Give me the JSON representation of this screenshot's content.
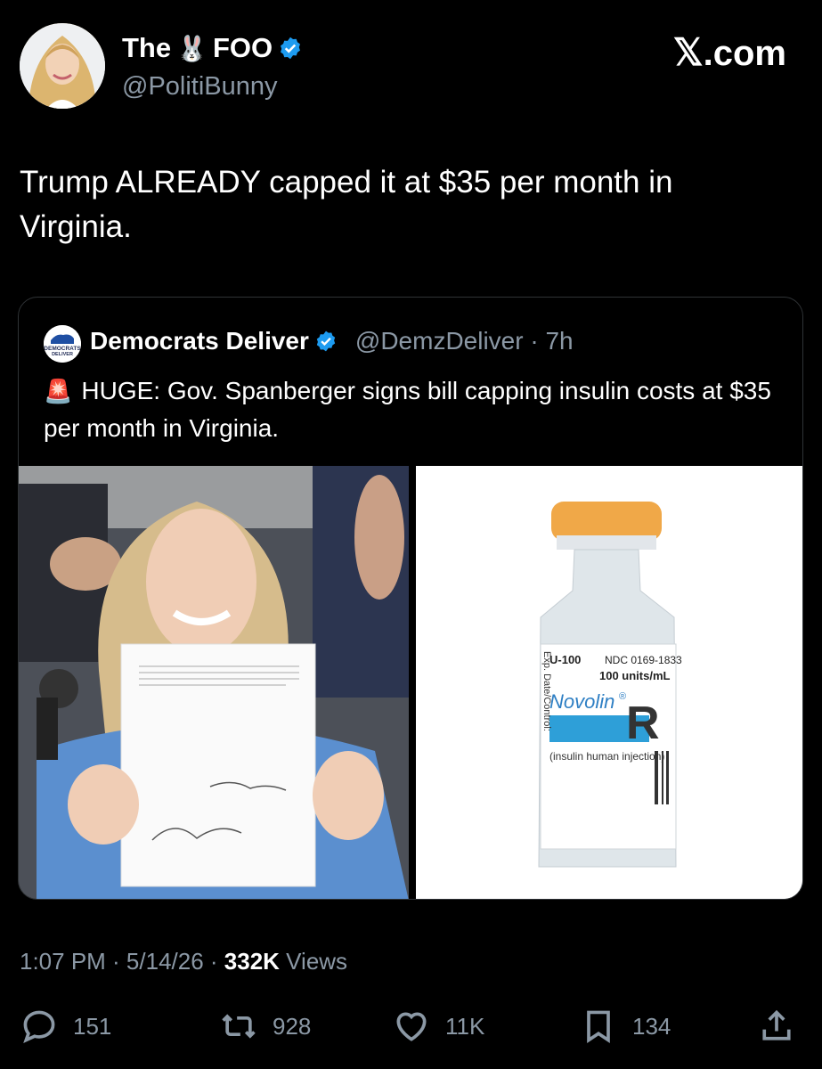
{
  "author": {
    "name_prefix": "The",
    "name_emoji": "🐰",
    "name_suffix": "FOO",
    "handle": "@PolitiBunny"
  },
  "brand": {
    "logo_x": "𝕏",
    "logo_suffix": ".com"
  },
  "tweet": {
    "text": "Trump ALREADY capped it at $35 per month in Virginia."
  },
  "quote": {
    "avatar_text": "DEMOCRATS DELIVER",
    "name": "Democrats Deliver",
    "handle": "@DemzDeliver · 7h",
    "alert_emoji": "🚨",
    "text": "HUGE: Gov. Spanberger signs bill capping insulin costs at $35 per month in Virginia."
  },
  "vial": {
    "u100": "U-100",
    "ndc": "NDC 0169-1833",
    "units": "100 units/mL",
    "brand": "Novolin",
    "reg": "®",
    "letter": "R",
    "desc": "(insulin human injection)",
    "side": "Exp. Date/Control:"
  },
  "meta": {
    "time": "1:07 PM · 5/14/26 · ",
    "views_count": "332K",
    "views_label": " Views"
  },
  "actions": {
    "replies": "151",
    "reposts": "928",
    "likes": "11K",
    "bookmarks": "134"
  },
  "colors": {
    "verified": "#1d9bf0",
    "muted": "#8b98a5",
    "vial_cap": "#f0a848",
    "label_blue": "#2e9fd8"
  }
}
